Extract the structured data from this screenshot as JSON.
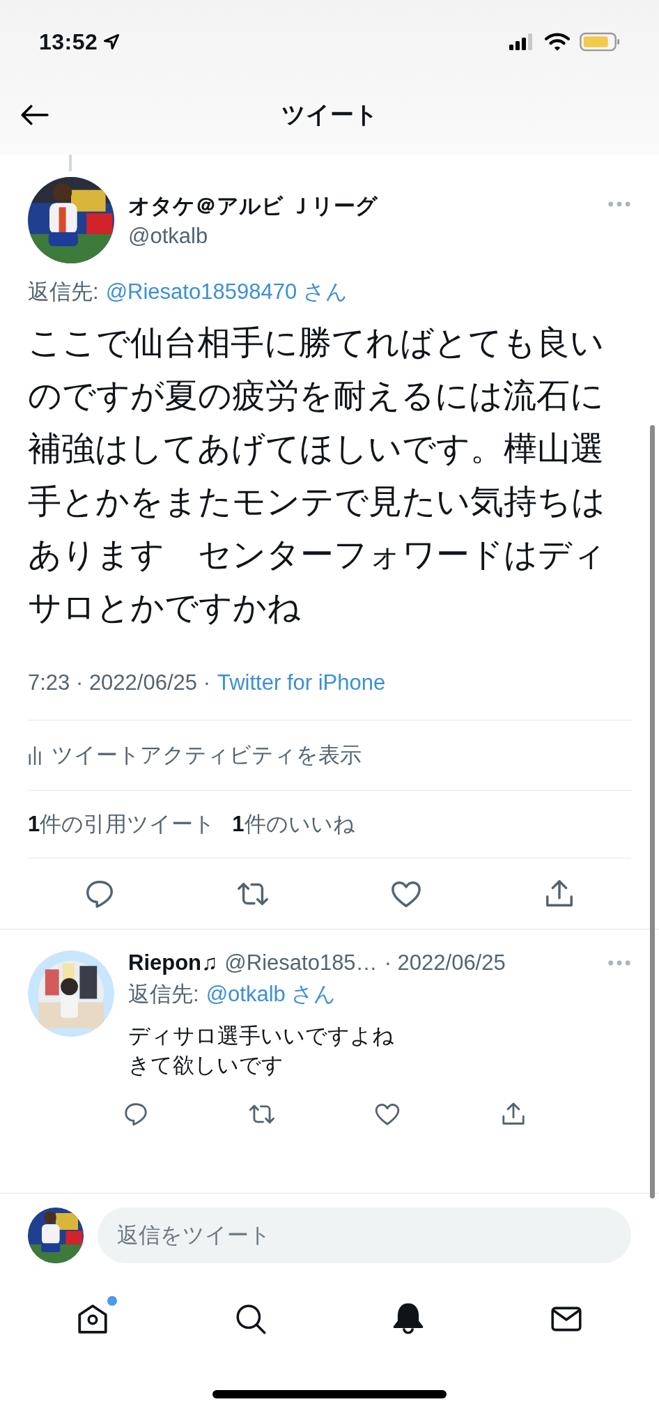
{
  "status_bar": {
    "time": "13:52"
  },
  "header": {
    "title": "ツイート"
  },
  "tweet": {
    "author": {
      "name": "オタケ＠アルビ Ｊリーグ",
      "handle": "@otkalb"
    },
    "reply_to": {
      "label": "返信先:",
      "handle": "@Riesato18598470 さん"
    },
    "text": "ここで仙台相手に勝てればとても良いのですが夏の疲労を耐えるには流石に補強はしてあげてほしいです。樺山選手とかをまたモンテで見たい気持ちはあります　センターフォワードはディサロとかですかね",
    "meta": {
      "time": "7:23 · 2022/06/25 ·",
      "source": "Twitter for iPhone"
    },
    "activity": "ツイートアクティビティを表示",
    "stats": [
      "**1**件の引用ツイート",
      "**1**件のいいね"
    ]
  },
  "replies": [
    {
      "name": "Riepon♫",
      "handle": "@Riesato185…",
      "date": "· 2022/06/25",
      "reply_to": {
        "label": "返信先:",
        "handle": "@otkalb さん"
      },
      "lines": [
        "ディサロ選手いいですよね",
        "きて欲しいです"
      ]
    }
  ],
  "composer": {
    "placeholder": "返信をツイート"
  },
  "nav": [
    {
      "kind": "home",
      "badge": true
    },
    {
      "kind": "search",
      "badge": false
    },
    {
      "kind": "notifications",
      "badge": false
    },
    {
      "kind": "messages",
      "badge": false
    }
  ]
}
